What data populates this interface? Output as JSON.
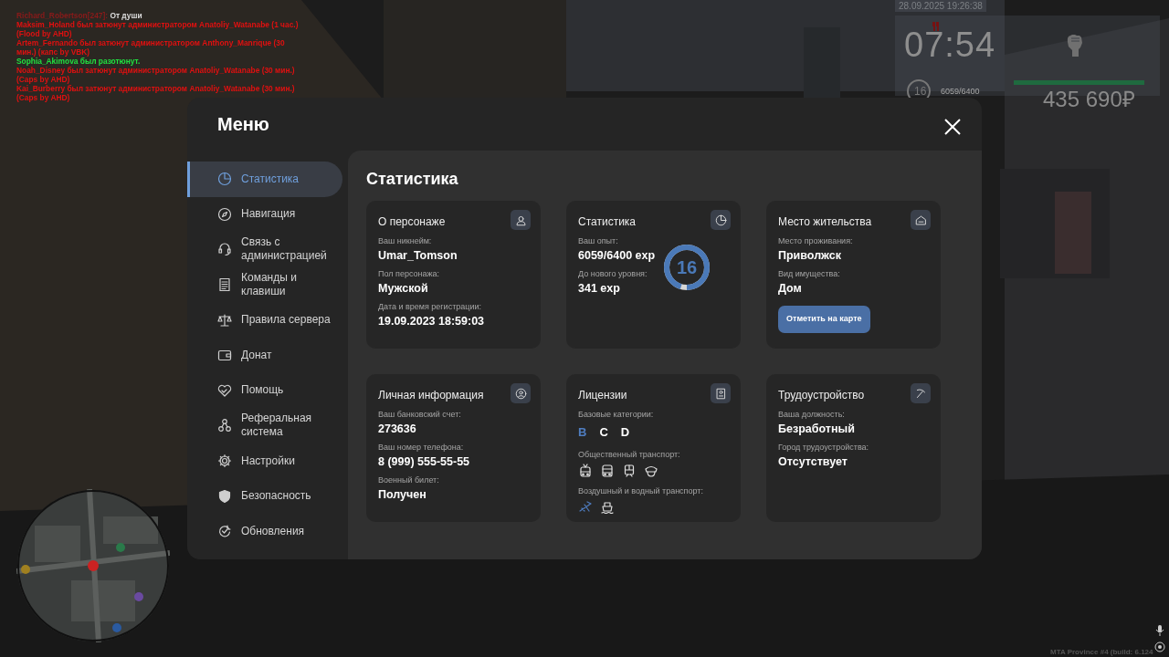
{
  "chat": [
    {
      "author": "Richard_Robertson[247]:",
      "text": "От души",
      "color": "#8a1a1a"
    },
    {
      "text": "Maksim_Holand был затюнут администратором Anatoliy_Watanabe (1 час.) (Flood by AHD)",
      "color": "#e01010"
    },
    {
      "text": "Artem_Fernando был затюнут администратором Anthony_Manrique (30 мин.) (капс by VBK)",
      "color": "#e01010"
    },
    {
      "text": "Sophia_Akimova был разотюнут.",
      "color": "#20e040"
    },
    {
      "text": "Noah_Disney был затюнут администратором Anatoliy_Watanabe (30 мин.) (Caps by AHD)",
      "color": "#e01010"
    },
    {
      "text": "Kai_Burberry был затюнут администратором Anatoliy_Watanabe (30 мин.) (Caps by AHD)",
      "color": "#e01010"
    }
  ],
  "hud": {
    "date": "28.09.2025 19:26:38",
    "time": "07:54",
    "level_number": "16",
    "exp": "6059/6400",
    "health_bar": {
      "level": 1
    },
    "money": "435 690₽"
  },
  "menu": {
    "title": "Меню",
    "nav": [
      {
        "label": "Статистика",
        "kind": "pie",
        "selected": true
      },
      {
        "label": "Навигация",
        "kind": "compass",
        "selected": false
      },
      {
        "label": "Связь с администрацией",
        "kind": "headset",
        "selected": false
      },
      {
        "label": "Команды и клавиши",
        "kind": "document",
        "selected": false
      },
      {
        "label": "Правила сервера",
        "kind": "scales",
        "selected": false
      },
      {
        "label": "Донат",
        "kind": "wallet",
        "selected": false
      },
      {
        "label": "Помощь",
        "kind": "heart",
        "selected": false
      },
      {
        "label": "Реферальная система",
        "kind": "network",
        "selected": false
      },
      {
        "label": "Настройки",
        "kind": "gear",
        "selected": false
      },
      {
        "label": "Безопасность",
        "kind": "shield",
        "selected": false
      },
      {
        "label": "Обновления",
        "kind": "refresh",
        "selected": false
      }
    ],
    "content_title": "Статистика",
    "cards": [
      {
        "title": "О персонаже",
        "kind": "fields",
        "fields": [
          {
            "label": "Ваш никнейм:",
            "value": "Umar_Tomson"
          },
          {
            "label": "Пол персонажа:",
            "value": "Мужской"
          },
          {
            "label": "Дата и время регистрации:",
            "value": "19.09.2023 18:59:03"
          }
        ]
      },
      {
        "title": "Статистика",
        "kind": "progress",
        "fields": [
          {
            "label": "Ваш опыт:",
            "value": "6059/6400 exp"
          },
          {
            "label": "До нового уровня:",
            "value": "341 exp"
          }
        ],
        "ring": {
          "label": "16",
          "level": 0.947
        }
      },
      {
        "title": "Место жительства",
        "kind": "fields",
        "fields": [
          {
            "label": "Место проживания:",
            "value": "Приволжск"
          },
          {
            "label": "Вид имущества:",
            "value": "Дом"
          }
        ],
        "button": "Отметить на карте"
      },
      {
        "title": "Личная информация",
        "kind": "fields",
        "fields": [
          {
            "label": "Ваш банковский счет:",
            "value": "273636"
          },
          {
            "label": "Ваш номер телефона:",
            "value": "8 (999) 555-55-55"
          },
          {
            "label": "Военный билет:",
            "value": "Получен"
          }
        ]
      },
      {
        "title": "Лицензии",
        "kind": "licenses",
        "sections": [
          {
            "label": "Базовые категории:",
            "items": [
              {
                "kind": "letter",
                "text": "B",
                "active": true
              },
              {
                "kind": "letter",
                "text": "C",
                "active": false
              },
              {
                "kind": "letter",
                "text": "D",
                "active": false
              }
            ]
          },
          {
            "label": "Общественный транспорт:",
            "items": [
              {
                "kind": "trolleybus",
                "active": false
              },
              {
                "kind": "bus",
                "active": false
              },
              {
                "kind": "train",
                "active": false
              },
              {
                "kind": "cap",
                "active": false
              }
            ]
          },
          {
            "label": "Воздушный и водный транспорт:",
            "items": [
              {
                "kind": "plane",
                "active": true
              },
              {
                "kind": "ship",
                "active": false
              }
            ]
          }
        ]
      },
      {
        "title": "Трудоустройство",
        "kind": "fields",
        "fields": [
          {
            "label": "Ваша должность:",
            "value": "Безработный"
          },
          {
            "label": "Город трудоустройства:",
            "value": "Отсутствует"
          }
        ]
      }
    ]
  },
  "build_info": "MTA Province #4 (build: 6.124"
}
